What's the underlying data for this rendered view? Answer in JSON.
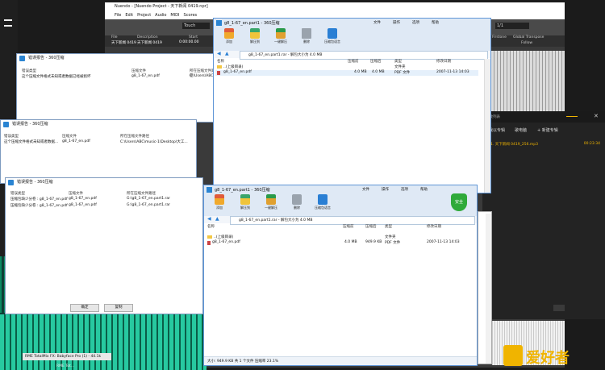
{
  "nuendo": {
    "title": "Nuendo - [Nuendo Project - 天下新闻 0419.npr]",
    "menus": [
      "File",
      "Edit",
      "Project",
      "Audio",
      "MIDI",
      "Scores",
      "Media",
      "Transport",
      "Devices",
      "Window",
      "Help"
    ],
    "touch": "Touch",
    "fields": {
      "file_h": "File",
      "file_v": "天下新闻 0419",
      "desc_h": "Description",
      "desc_v": "天下新闻 0419",
      "start_h": "Start",
      "start_v": "0:00:00.00"
    },
    "right": {
      "pos": "1/1",
      "firstone": "Firstone",
      "transpose": "Global Transpose",
      "follow": "Follow"
    }
  },
  "player": {
    "btn1": "我以专辑",
    "btn2": "歌电脑",
    "btn3": "+ 新建专辑",
    "song": "1. 天下新闻 0419_256.mp3",
    "time": "00:23:34",
    "title": "播放列表"
  },
  "err1": {
    "title": "错误报告 - 360压缩",
    "cols": [
      "错误类型",
      "压缩文件",
      "所在压缩文件路径"
    ],
    "row": [
      "这个压缩文件格式未知或者数据已经被损坏",
      "g8_1-67_en.pdf",
      "C:\\Users\\ABC"
    ]
  },
  "err2": {
    "title": "错误报告 - 360压缩",
    "cols": [
      "错误类型",
      "压缩文件",
      "所在压缩文件路径"
    ],
    "row": [
      "这个压缩文件格式未知或者数据...",
      "g8_1-67_en.pdf",
      "C:\\Users\\ABC\\music-1\\Desktop\\大工..."
    ]
  },
  "err3": {
    "title": "错误报告 - 360压缩",
    "cols": [
      "错误类型",
      "压缩文件",
      "所在压缩文件路径"
    ],
    "rows": [
      [
        "压缩包缺少分卷 : g8_1-67_en.pdf",
        "g8_1-67_en.pdf",
        "G:\\g8_1-67_en.part1.rar"
      ],
      [
        "压缩包缺少分卷 : g8_1-67_en.pdf",
        "g8_1-67_en.pdf",
        "G:\\g8_1-67_en.part1.rar"
      ]
    ],
    "ok": "确定",
    "copy": "复制"
  },
  "zip1": {
    "title": "g8_1-67_en.part1 - 360压缩",
    "menus": [
      "文件",
      "操作",
      "选项",
      "帮助"
    ],
    "tools": [
      "添加",
      "解压到",
      "一键解压",
      "删除",
      "压缩包语言"
    ],
    "addr": "g8_1-67_en.part1.rar - 解包大小为 4.0 MB",
    "cols": [
      "名称",
      "压缩前",
      "压缩后",
      "类型",
      "修改日期"
    ],
    "parent": "..(上级目录)",
    "parent_type": "文件夹",
    "file": {
      "name": "g8_1-67_en.pdf",
      "before": "4.0 MB",
      "after": "4.0 MB",
      "type": "PDF 文件",
      "date": "2007-11-13 14:03"
    }
  },
  "zip2": {
    "title": "g8_1-67_en.part1 - 360压缩",
    "menus": [
      "文件",
      "操作",
      "选项",
      "帮助"
    ],
    "tools": [
      "添加",
      "解压到",
      "一键解压",
      "删除",
      "压缩包语言"
    ],
    "safe": "安全",
    "addr": "g8_1-67_en.part1.rar - 解包大小为 4.0 MB",
    "cols": [
      "名称",
      "压缩前",
      "压缩后",
      "类型",
      "修改日期"
    ],
    "parent": "..(上级目录)",
    "parent_type": "文件夹",
    "file": {
      "name": "g8_1-67_en.pdf",
      "before": "4.0 MB",
      "after": "949.9 KB",
      "type": "PDF 文件",
      "date": "2007-11-13 14:03"
    },
    "status": "大小: 949.9 KB 共 1 个文件 压缩率 23.1%"
  },
  "bottom": {
    "rme": "RME TotalMix FX: Babyface Pro (1) - 44.1k",
    "rme2": "RME Tot..."
  },
  "watermark": "爱好者",
  "colors": {
    "nuendo_bg": "#3a3a3a",
    "player_bg": "#232323",
    "accent": "#f0b400",
    "green": "#1fa37b"
  }
}
